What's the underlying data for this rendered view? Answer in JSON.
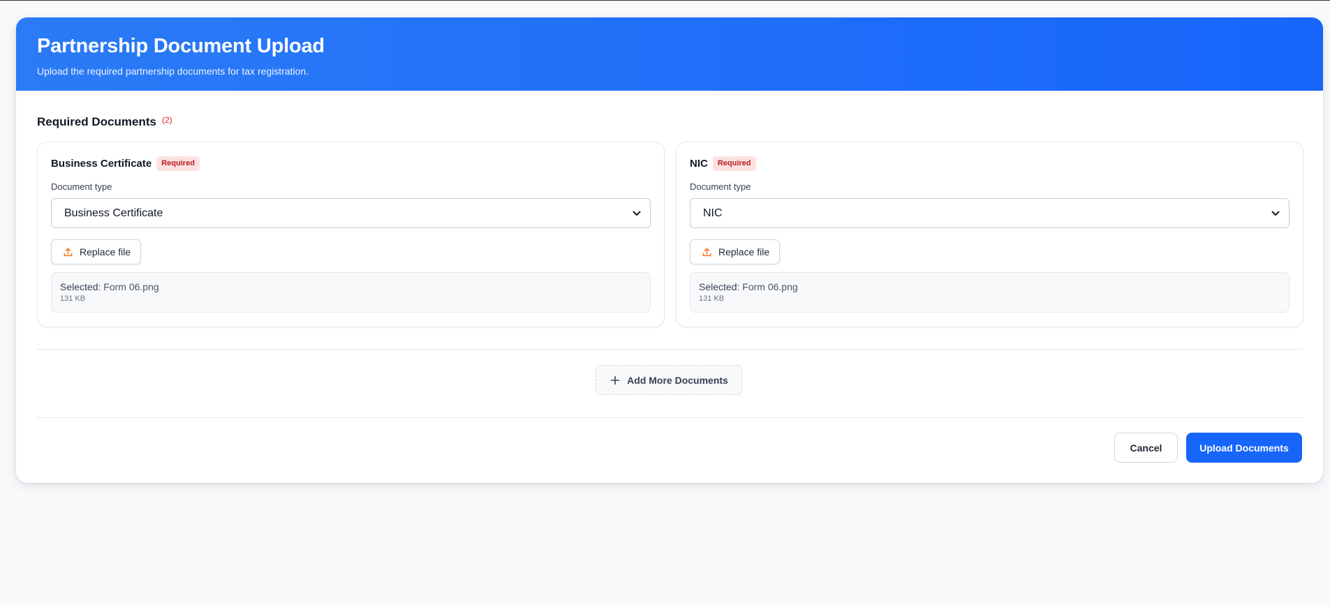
{
  "header": {
    "title": "Partnership Document Upload",
    "subtitle": "Upload the required partnership documents for tax registration."
  },
  "required_section": {
    "title": "Required Documents",
    "count": "(2)"
  },
  "documents": [
    {
      "name": "Business Certificate",
      "badge": "Required",
      "field_label": "Document type",
      "selected_type": "Business Certificate",
      "replace_label": "Replace file",
      "selected_label": "Selected:",
      "file_name": "Form 06.png",
      "file_size": "131 KB"
    },
    {
      "name": "NIC",
      "badge": "Required",
      "field_label": "Document type",
      "selected_type": "NIC",
      "replace_label": "Replace file",
      "selected_label": "Selected:",
      "file_name": "Form 06.png",
      "file_size": "131 KB"
    }
  ],
  "add_more": {
    "label": "Add More Documents",
    "icon": "plus-icon"
  },
  "footer": {
    "cancel_label": "Cancel",
    "upload_label": "Upload Documents"
  },
  "colors": {
    "primary": "#1766fb",
    "required": "#dc2626",
    "upload_icon": "#f97316"
  },
  "icons": {
    "upload": "upload-icon",
    "select": "chevron-down-icon"
  }
}
